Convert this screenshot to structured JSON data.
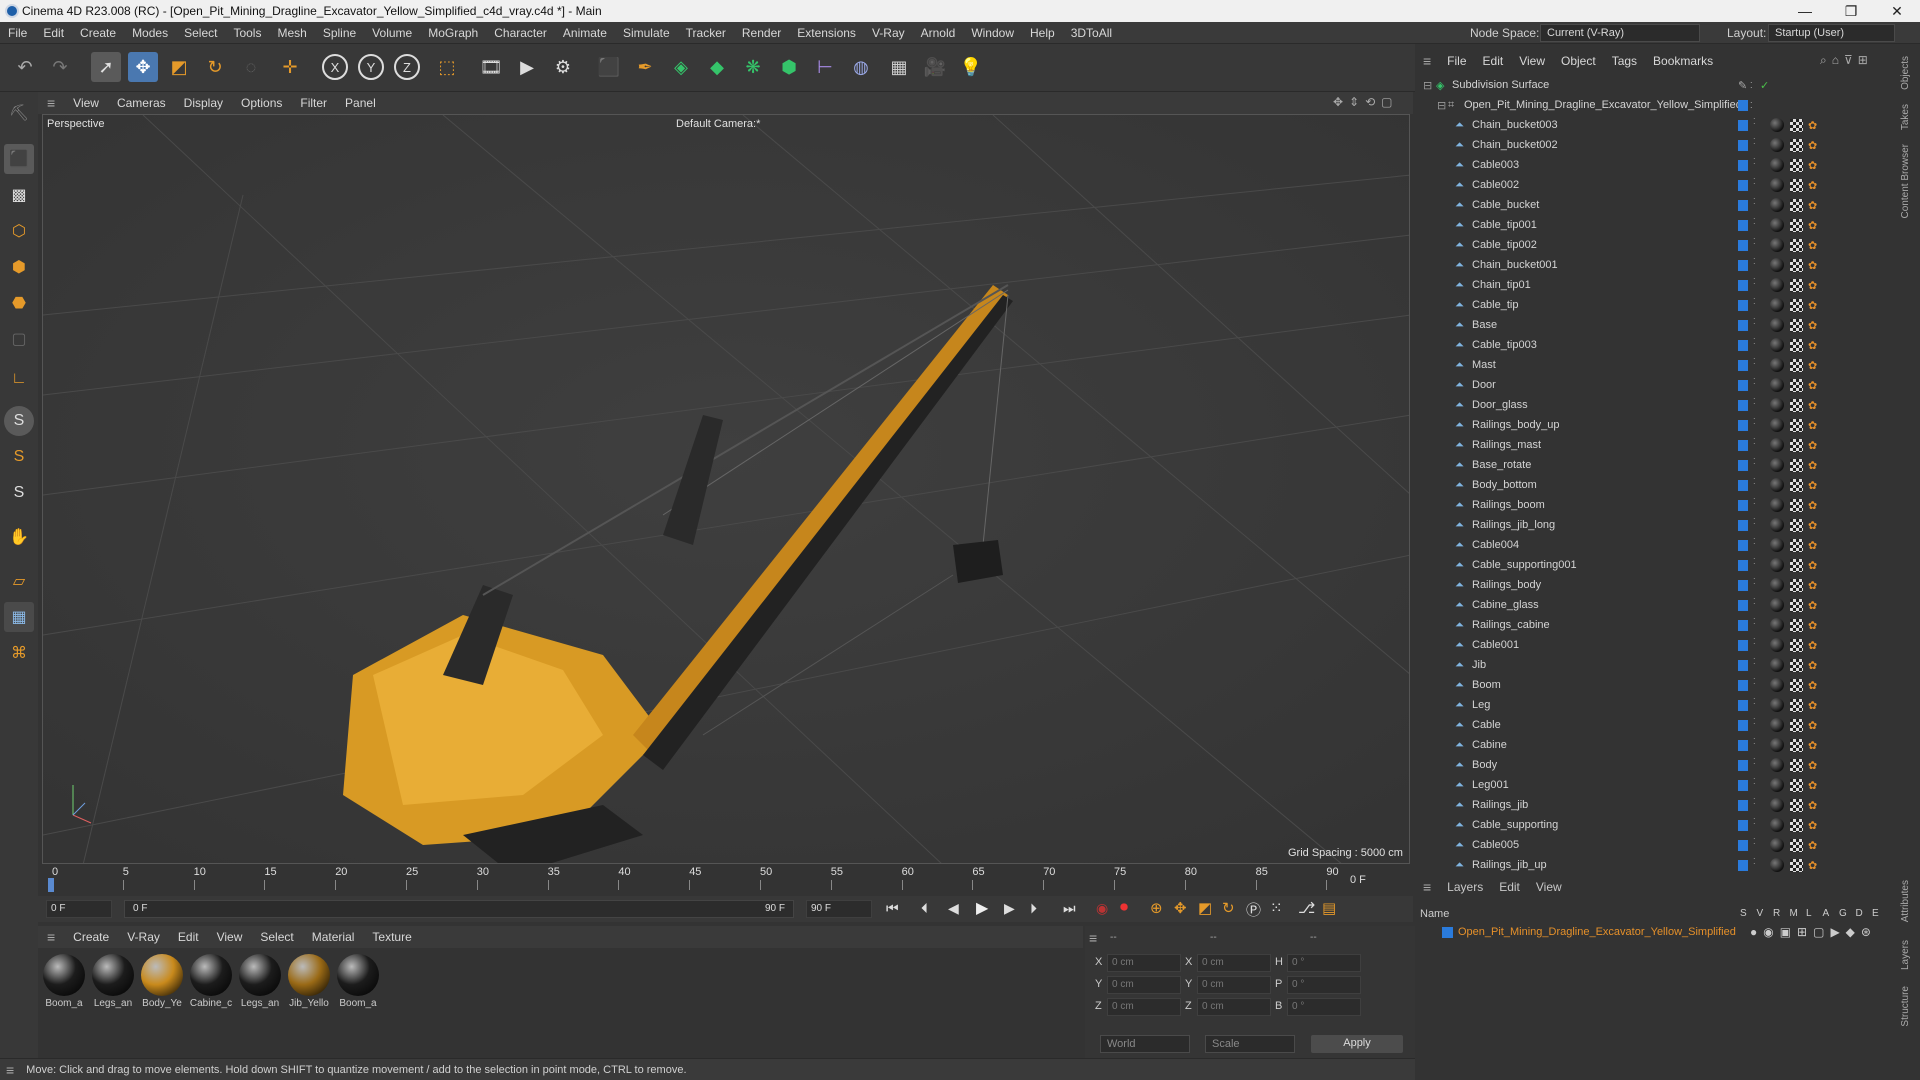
{
  "window": {
    "title": "Cinema 4D R23.008 (RC) - [Open_Pit_Mining_Dragline_Excavator_Yellow_Simplified_c4d_vray.c4d *] - Main",
    "minimize": "—",
    "maximize": "❐",
    "close": "✕"
  },
  "menu": [
    "File",
    "Edit",
    "Create",
    "Modes",
    "Select",
    "Tools",
    "Mesh",
    "Spline",
    "Volume",
    "MoGraph",
    "Character",
    "Animate",
    "Simulate",
    "Tracker",
    "Render",
    "Extensions",
    "V-Ray",
    "Arnold",
    "Window",
    "Help",
    "3DToAll"
  ],
  "node_space": {
    "label": "Node Space:",
    "value": "Current (V-Ray)"
  },
  "layout": {
    "label": "Layout:",
    "value": "Startup (User)"
  },
  "viewport_menu": [
    "View",
    "Cameras",
    "Display",
    "Options",
    "Filter",
    "Panel"
  ],
  "viewport": {
    "name": "Perspective",
    "camera": "Default Camera",
    "camera_suffix": ":*",
    "grid_spacing": "Grid Spacing : 5000 cm"
  },
  "timeline": {
    "ticks": [
      "0",
      "5",
      "10",
      "15",
      "20",
      "25",
      "30",
      "35",
      "40",
      "45",
      "50",
      "55",
      "60",
      "65",
      "70",
      "75",
      "80",
      "85",
      "90"
    ],
    "current_frame": "0 F",
    "start": "0 F",
    "range_start": "0 F",
    "range_end": "90 F",
    "end": "90 F"
  },
  "material_menu": [
    "Create",
    "V-Ray",
    "Edit",
    "View",
    "Select",
    "Material",
    "Texture"
  ],
  "materials": [
    {
      "name": "Boom_a",
      "color": "#1c1c1c"
    },
    {
      "name": "Legs_an",
      "color": "#1c1c1c"
    },
    {
      "name": "Body_Ye",
      "color": "#c98a1c"
    },
    {
      "name": "Cabine_c",
      "color": "#1c1c1c"
    },
    {
      "name": "Legs_an",
      "color": "#1c1c1c"
    },
    {
      "name": "Jib_Yello",
      "color": "#9a6a16"
    },
    {
      "name": "Boom_a",
      "color": "#1c1c1c"
    }
  ],
  "coords": {
    "header": [
      "--",
      "--",
      "--"
    ],
    "rows": [
      [
        "X",
        "0 cm",
        "X",
        "0 cm",
        "H",
        "0 °"
      ],
      [
        "Y",
        "0 cm",
        "Y",
        "0 cm",
        "P",
        "0 °"
      ],
      [
        "Z",
        "0 cm",
        "Z",
        "0 cm",
        "B",
        "0 °"
      ]
    ],
    "world": "World",
    "scale": "Scale",
    "apply": "Apply"
  },
  "status": "Move: Click and drag to move elements. Hold down SHIFT to quantize movement / add to the selection in point mode, CTRL to remove.",
  "object_menu": [
    "File",
    "Edit",
    "View",
    "Object",
    "Tags",
    "Bookmarks"
  ],
  "objects": {
    "root": "Subdivision Surface",
    "parent": "Open_Pit_Mining_Dragline_Excavator_Yellow_Simplified",
    "children": [
      "Chain_bucket003",
      "Chain_bucket002",
      "Cable003",
      "Cable002",
      "Cable_bucket",
      "Cable_tip001",
      "Cable_tip002",
      "Chain_bucket001",
      "Chain_tip01",
      "Cable_tip",
      "Base",
      "Cable_tip003",
      "Mast",
      "Door",
      "Door_glass",
      "Railings_body_up",
      "Railings_mast",
      "Base_rotate",
      "Body_bottom",
      "Railings_boom",
      "Railings_jib_long",
      "Cable004",
      "Cable_supporting001",
      "Railings_body",
      "Cabine_glass",
      "Railings_cabine",
      "Cable001",
      "Jib",
      "Boom",
      "Leg",
      "Cable",
      "Cabine",
      "Body",
      "Leg001",
      "Railings_jib",
      "Cable_supporting",
      "Cable005",
      "Railings_jib_up"
    ]
  },
  "layers_menu": [
    "Layers",
    "Edit",
    "View"
  ],
  "layers": {
    "header_name": "Name",
    "flags": [
      "S",
      "V",
      "R",
      "M",
      "L",
      "A",
      "G",
      "D",
      "E"
    ],
    "item": "Open_Pit_Mining_Dragline_Excavator_Yellow_Simplified"
  },
  "side_tabs": [
    "Objects",
    "Takes",
    "Content Browser",
    "Attributes",
    "Layers",
    "Structure"
  ],
  "colors": {
    "accent": "#2a7bdc",
    "layer": "#e5902a",
    "excavator": "#d89a24"
  }
}
